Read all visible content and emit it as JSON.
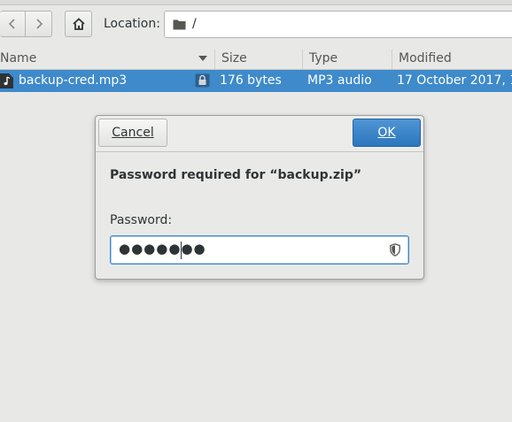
{
  "toolbar": {
    "location_label": "Location:",
    "location_value": "/"
  },
  "columns": [
    "Name",
    "Size",
    "Type",
    "Modified"
  ],
  "files": [
    {
      "name": "backup-cred.mp3",
      "size": "176 bytes",
      "type": "MP3 audio",
      "modified": "17 October 2017, 1…",
      "locked": true
    }
  ],
  "dialog": {
    "cancel_label": "Cancel",
    "ok_label": "OK",
    "message": "Password required for “backup.zip”",
    "password_label": "Password:",
    "password_mask": "●●●●●●●"
  },
  "colors": {
    "selection": "#3e8acb",
    "ok_button": "#2b77bd"
  }
}
